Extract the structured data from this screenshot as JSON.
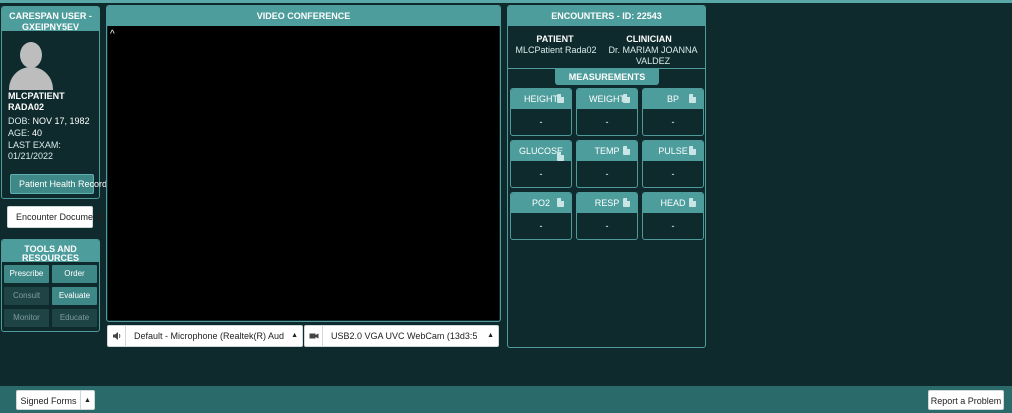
{
  "user_card": {
    "title": "CARESPAN USER - GXEIPNY5EV",
    "patient_name": "MLCPATIENT RADA02",
    "dob_label": "DOB:",
    "dob": "NOV 17, 1982",
    "age_label": "AGE:",
    "age": "40",
    "last_exam_label": "LAST EXAM:",
    "last_exam": "01/21/2022",
    "health_record_button": "Patient Health Record"
  },
  "encounter_documents_button": "Encounter Documents",
  "tools": {
    "title": "TOOLS AND RESOURCES",
    "buttons": [
      {
        "label": "Prescribe",
        "enabled": true
      },
      {
        "label": "Order",
        "enabled": true
      },
      {
        "label": "Consult",
        "enabled": false
      },
      {
        "label": "Evaluate",
        "enabled": true
      },
      {
        "label": "Monitor",
        "enabled": false
      },
      {
        "label": "Educate",
        "enabled": false
      }
    ]
  },
  "video": {
    "title": "VIDEO CONFERENCE",
    "collapse_glyph": "^",
    "microphone_select": "Default - Microphone (Realtek(R) Aud",
    "camera_select": "USB2.0 VGA UVC WebCam (13d3:5"
  },
  "encounters": {
    "title": "ENCOUNTERS - ID: 22543",
    "patient_header": "PATIENT",
    "patient_value": "MLCPatient Rada02",
    "clinician_header": "CLINICIAN",
    "clinician_value": "Dr. MARIAM JOANNA VALDEZ",
    "measurements_tab": "MEASUREMENTS",
    "cards": [
      {
        "label": "HEIGHT",
        "value": "-"
      },
      {
        "label": "WEIGHT",
        "value": "-"
      },
      {
        "label": "BP",
        "value": "-"
      },
      {
        "label": "GLUCOSE",
        "value": "-"
      },
      {
        "label": "TEMP",
        "value": "-"
      },
      {
        "label": "PULSE",
        "value": "-"
      },
      {
        "label": "PO2",
        "value": "-"
      },
      {
        "label": "RESP",
        "value": "-"
      },
      {
        "label": "HEAD",
        "value": "-"
      }
    ]
  },
  "footer": {
    "signed_forms": "Signed Forms",
    "report_problem": "Report a Problem"
  },
  "colors": {
    "background": "#0f2a2d",
    "accent": "#4e9d9d",
    "button": "#3f8888"
  },
  "icons": {
    "speaker": "speaker-icon",
    "camera": "camera-icon",
    "document": "document-icon"
  }
}
